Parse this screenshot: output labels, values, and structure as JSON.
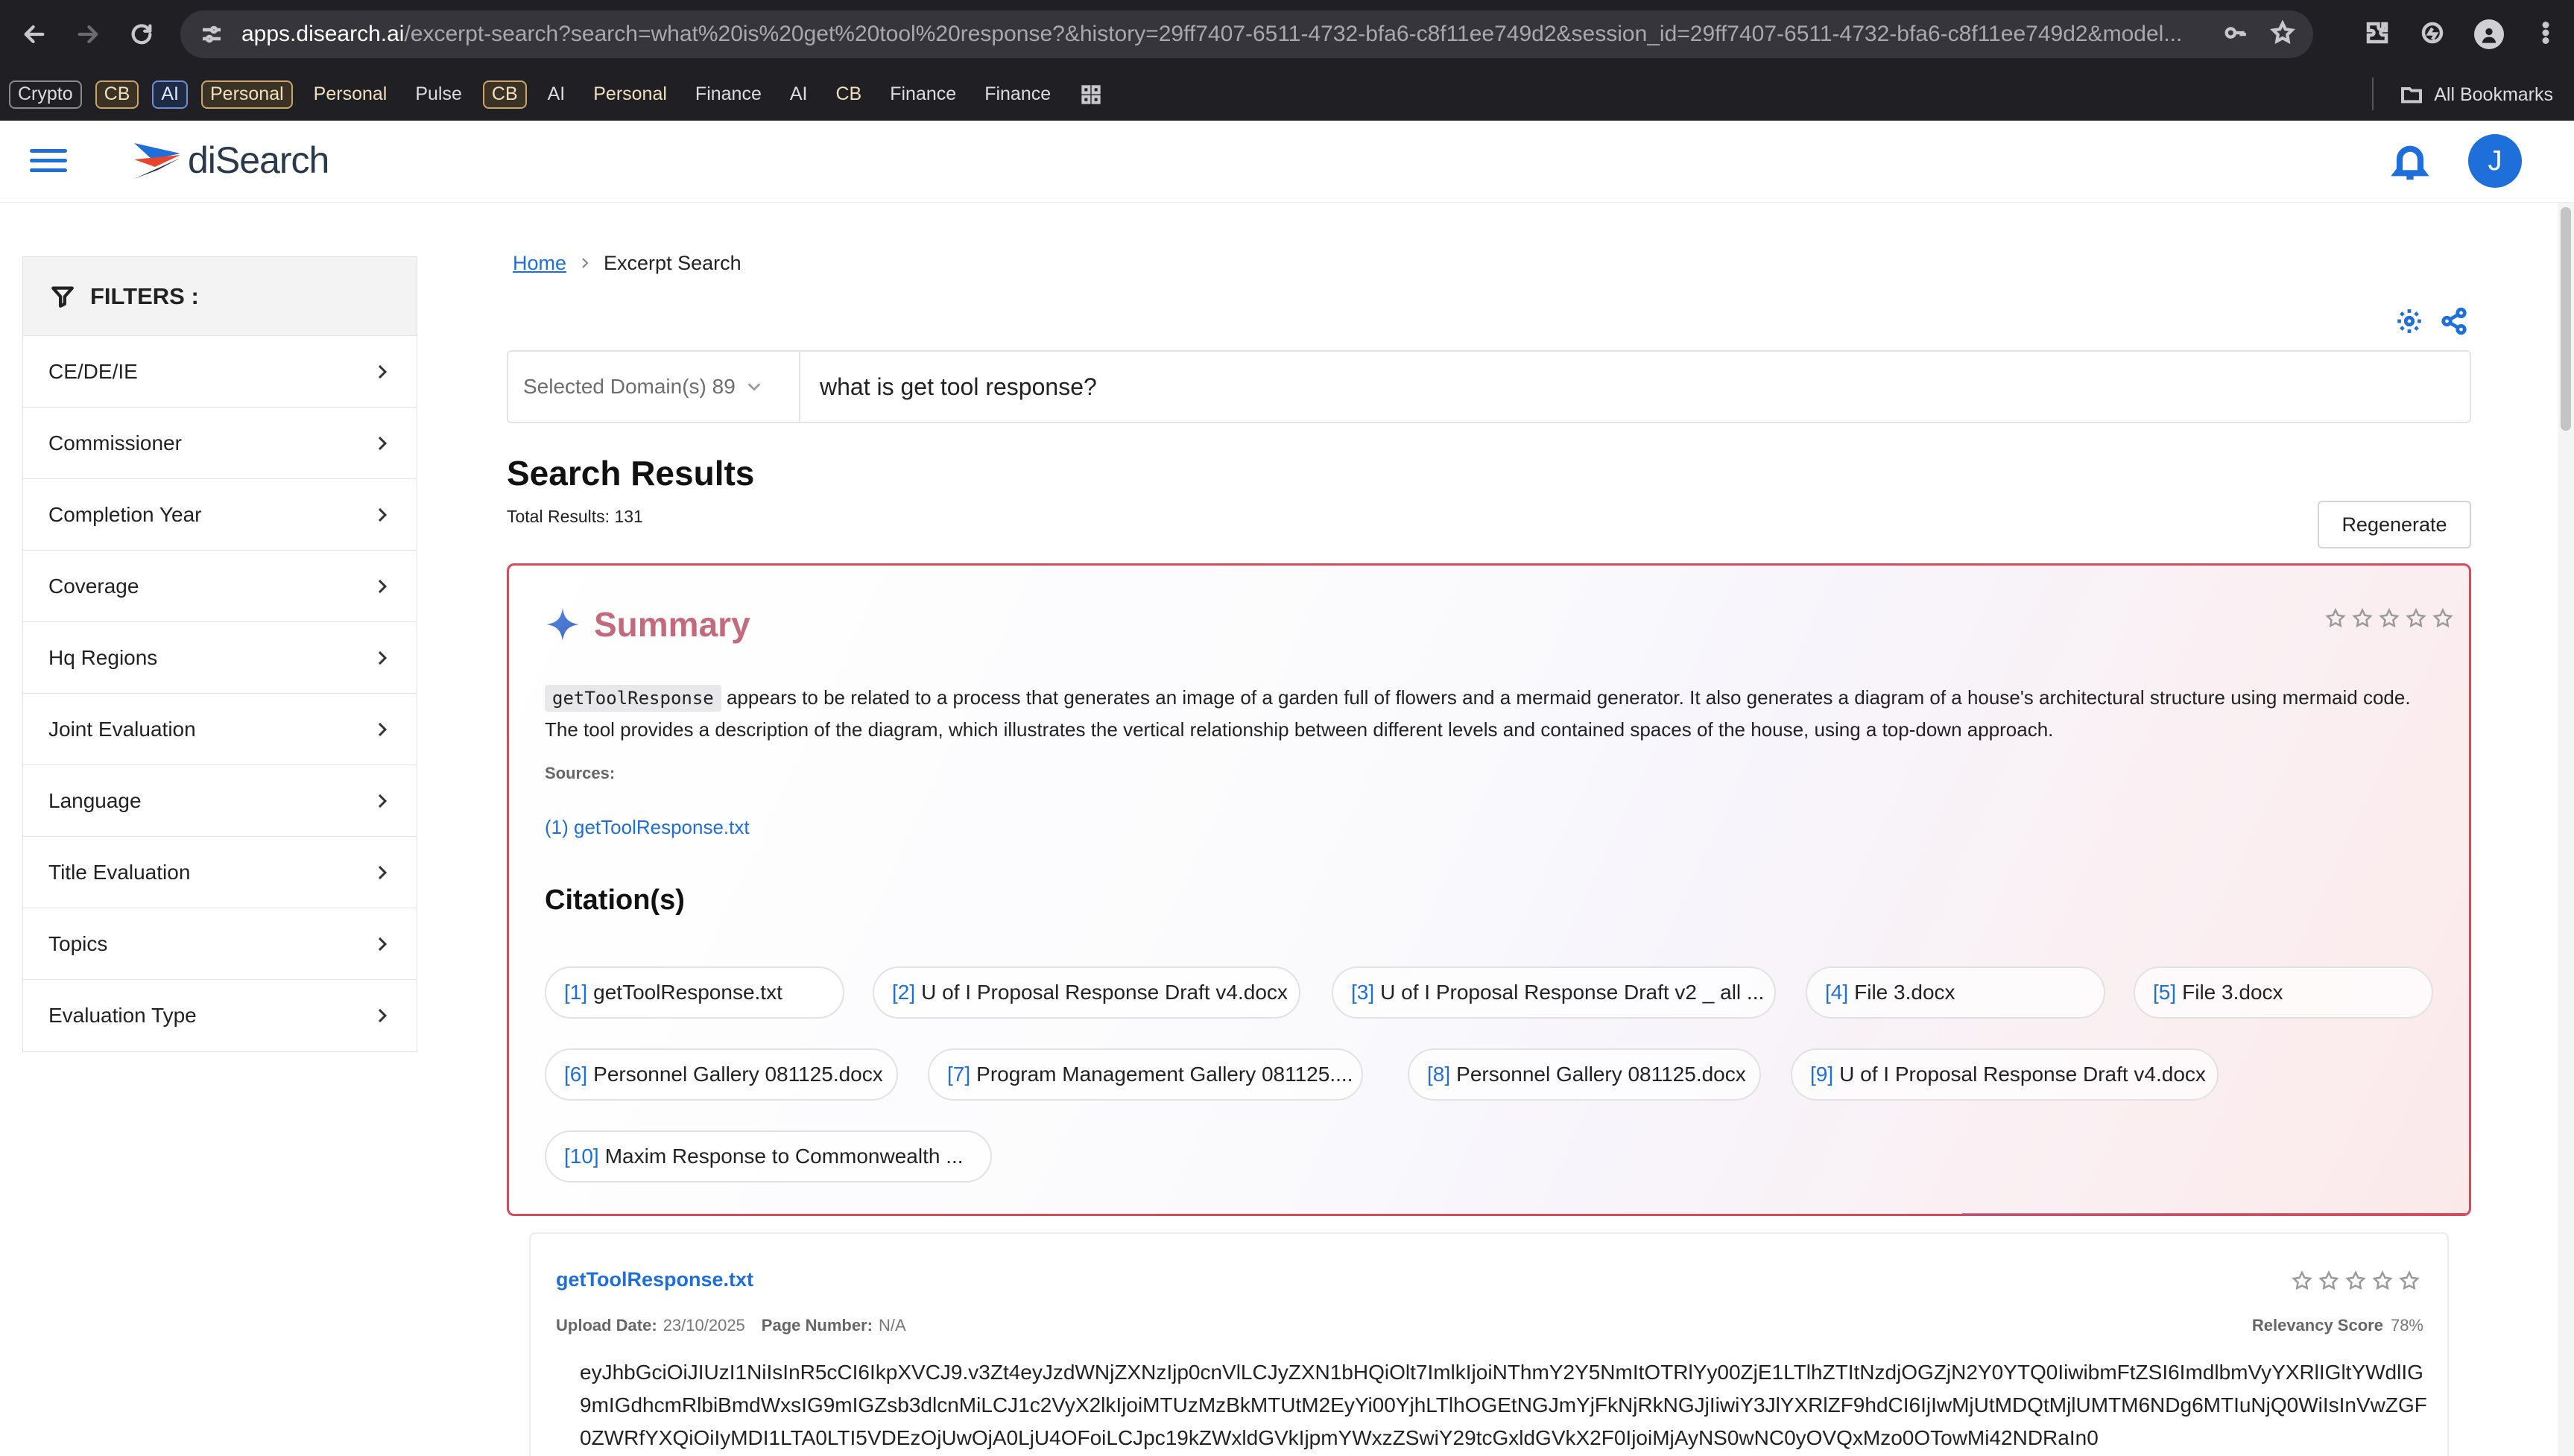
{
  "browser": {
    "url_domain": "apps.disearch.ai",
    "url_rest": "/excerpt-search?search=what%20is%20get%20tool%20response?&history=29ff7407-6511-4732-bfa6-c8f11ee749d2&session_id=29ff7407-6511-4732-bfa6-c8f11ee749d2&model...",
    "bookmarks": [
      "Crypto",
      "CB",
      "AI",
      "Personal",
      "Personal",
      "Pulse",
      "CB",
      "AI",
      "Personal",
      "Finance",
      "AI",
      "CB",
      "Finance",
      "Finance"
    ],
    "all_bookmarks": "All Bookmarks"
  },
  "header": {
    "logo_text": "diSearch",
    "avatar_initial": "J"
  },
  "filters": {
    "title": "FILTERS :",
    "items": [
      "CE/DE/IE",
      "Commissioner",
      "Completion Year",
      "Coverage",
      "Hq Regions",
      "Joint Evaluation",
      "Language",
      "Title Evaluation",
      "Topics",
      "Evaluation Type"
    ]
  },
  "breadcrumb": {
    "home": "Home",
    "current": "Excerpt Search"
  },
  "search": {
    "domain_label": "Selected Domain(s) 89",
    "query": "what is get tool response?"
  },
  "results": {
    "title": "Search Results",
    "total": "Total Results: 131",
    "regenerate": "Regenerate"
  },
  "summary": {
    "title": "Summary",
    "code_term": "getToolResponse",
    "text": " appears to be related to a process that generates an image of a garden full of flowers and a mermaid generator. It also generates a diagram of a house's architectural structure using mermaid code. The tool provides a description of the diagram, which illustrates the vertical relationship between different levels and contained spaces of the house, using a top-down approach.",
    "sources_label": "Sources:",
    "source_link": "(1) getToolResponse.txt",
    "citations_title": "Citation(s)",
    "citations": [
      {
        "num": "[1]",
        "label": "getToolResponse.txt"
      },
      {
        "num": "[2]",
        "label": "U of I Proposal Response Draft v4.docx"
      },
      {
        "num": "[3]",
        "label": "U of I Proposal Response Draft v2 _ all ..."
      },
      {
        "num": "[4]",
        "label": "File 3.docx"
      },
      {
        "num": "[5]",
        "label": "File 3.docx"
      },
      {
        "num": "[6]",
        "label": "Personnel Gallery 081125.docx"
      },
      {
        "num": "[7]",
        "label": "Program Management Gallery 081125...."
      },
      {
        "num": "[8]",
        "label": "Personnel Gallery 081125.docx"
      },
      {
        "num": "[9]",
        "label": "U of I Proposal Response Draft v4.docx"
      },
      {
        "num": "[10]",
        "label": "Maxim Response to Commonwealth ..."
      }
    ]
  },
  "result": {
    "title": "getToolResponse.txt",
    "upload_label": "Upload Date:",
    "upload_value": "23/10/2025",
    "page_label": "Page Number:",
    "page_value": "N/A",
    "relevancy_label": "Relevancy Score",
    "relevancy_value": "78%",
    "body": "eyJhbGciOiJIUzI1NiIsInR5cCI6IkpXVCJ9.v3Zt4eyJzdWNjZXNzIjp0cnVlLCJyZXN1bHQiOlt7ImlkIjoiNThmY2Y5NmItOTRlYy00ZjE1LTlhZTItNzdjOGZjN2Y0YTQ0IiwibmFtZSI6ImdlbmVyYXRlIGltYWdlIG9mIGdhcmRlbiBmdWxsIG9mIGZsb3dlcnMiLCJ1c2VyX2lkIjoiMTUzMzBkMTUtM2EyYi00YjhLTlhOGEtNGJmYjFkNjRkNGJjIiwiY3JlYXRlZF9hdCI6IjIwMjUtMDQtMjlUMTM6NDg6MTIuNjQ0WiIsInVwZGF0ZWRfYXQiOiIyMDI1LTA0LTI5VDEzOjUwOjA0LjU4OFoiLCJpc19kZWxldGVkIjpmYWxzZSwiY29tcGxldGVkX2F0IjoiMjAyNS0wNC0yOVQxMzo0OTowMi42NDRaIn0"
  }
}
